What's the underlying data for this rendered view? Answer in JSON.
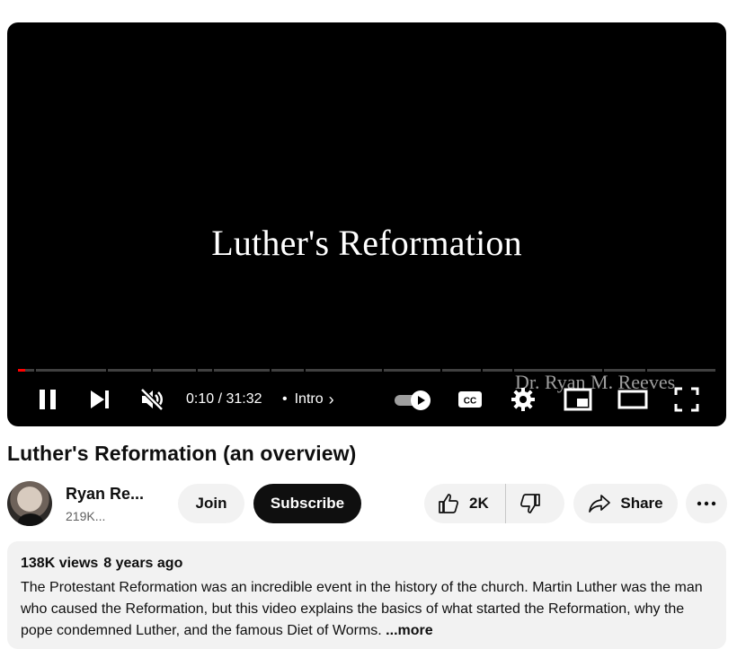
{
  "player": {
    "title_card": "Luther's Reformation",
    "watermark": "Dr. Ryan M. Reeves",
    "time": "0:10 / 31:32",
    "chapter_separator": "•",
    "chapter": "Intro",
    "progress": 0.01,
    "icons": [
      "pause-icon",
      "next-icon",
      "mute-icon",
      "autoplay-toggle-icon",
      "captions-icon",
      "settings-icon",
      "miniplayer-icon",
      "theater-icon",
      "fullscreen-icon"
    ]
  },
  "video": {
    "title": "Luther's Reformation (an overview)"
  },
  "owner": {
    "channel_name": "Ryan Re...",
    "subscribers": "219K...",
    "join_label": "Join",
    "subscribe_label": "Subscribe"
  },
  "actions": {
    "like_count": "2K",
    "share_label": "Share"
  },
  "description": {
    "views": "138K views",
    "age": "8 years ago",
    "text": "The Protestant Reformation was an incredible event in the history of the church. Martin Luther was the man who caused the Reformation, but this video explains the basics of what started the Reformation, why the pope condemned Luther, and the famous Diet of Worms.",
    "more_label": "...more"
  },
  "colors": {
    "accent": "#ff0000",
    "button_bg": "#f2f2f2",
    "subscribe_bg": "#0f0f0f"
  }
}
